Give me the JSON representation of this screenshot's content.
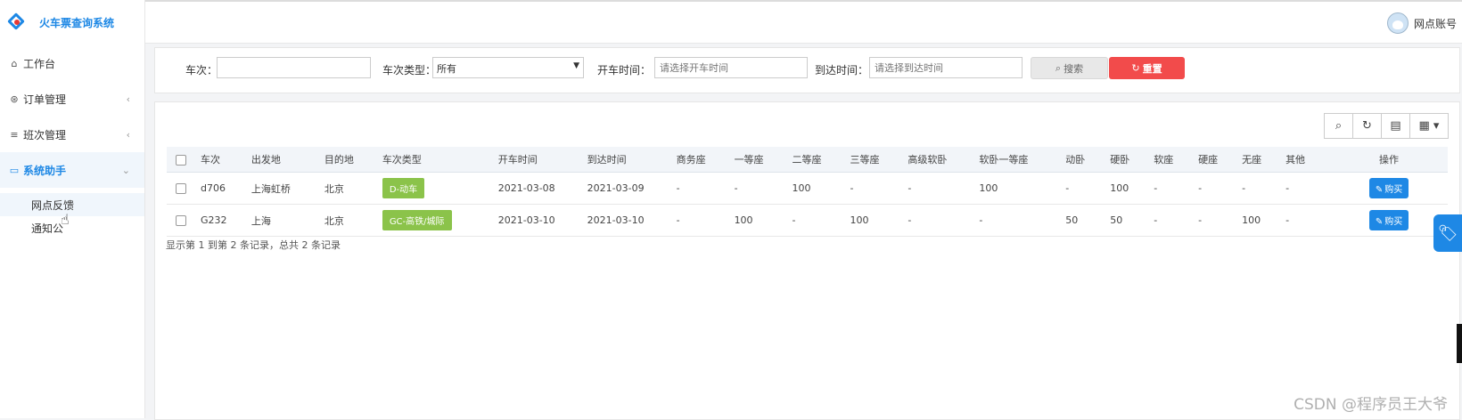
{
  "app": {
    "title": "火车票查询系统"
  },
  "header": {
    "user_label": "网点账号"
  },
  "sidebar": {
    "items": [
      {
        "label": "工作台",
        "icon": "home-icon"
      },
      {
        "label": "订单管理",
        "icon": "pin-icon"
      },
      {
        "label": "班次管理",
        "icon": "list-icon"
      },
      {
        "label": "系统助手",
        "icon": "laptop-icon"
      }
    ],
    "subitems": [
      {
        "label": "网点反馈"
      },
      {
        "label": "通知公"
      }
    ]
  },
  "search": {
    "train_no_label": "车次：",
    "train_no_value": "",
    "type_label": "车次类型：",
    "type_value": "所有",
    "depart_label": "开车时间：",
    "depart_placeholder": "请选择开车时间",
    "arrive_label": "到达时间：",
    "arrive_placeholder": "请选择到达时间",
    "search_btn": "搜索",
    "reset_btn": "重置"
  },
  "table": {
    "headers": [
      "车次",
      "出发地",
      "目的地",
      "车次类型",
      "开车时间",
      "到达时间",
      "商务座",
      "一等座",
      "二等座",
      "三等座",
      "高级软卧",
      "软卧一等座",
      "动卧",
      "硬卧",
      "软座",
      "硬座",
      "无座",
      "其他",
      "操作"
    ],
    "rows": [
      {
        "train": "d706",
        "from": "上海虹桥",
        "to": "北京",
        "type": "D-动车",
        "depart": "2021-03-08",
        "arrive": "2021-03-09",
        "business": "-",
        "first": "-",
        "second": "100",
        "third": "-",
        "premium_sleeper": "-",
        "soft_sleeper_first": "100",
        "d_sleeper": "-",
        "hard_sleeper": "100",
        "soft_seat": "-",
        "hard_seat": "-",
        "no_seat": "-",
        "other": "-",
        "action": "购买"
      },
      {
        "train": "G232",
        "from": "上海",
        "to": "北京",
        "type": "GC-高铁/城际",
        "depart": "2021-03-10",
        "arrive": "2021-03-10",
        "business": "-",
        "first": "100",
        "second": "-",
        "third": "100",
        "premium_sleeper": "-",
        "soft_sleeper_first": "-",
        "d_sleeper": "50",
        "hard_sleeper": "50",
        "soft_seat": "-",
        "hard_seat": "-",
        "no_seat": "100",
        "other": "-",
        "action": "购买"
      }
    ],
    "summary": "显示第 1 到第 2 条记录，总共 2 条记录"
  },
  "watermark": "CSDN @程序员王大爷",
  "colors": {
    "accent": "#1e88e5",
    "danger": "#f24b4b",
    "badge": "#8bc34a"
  }
}
